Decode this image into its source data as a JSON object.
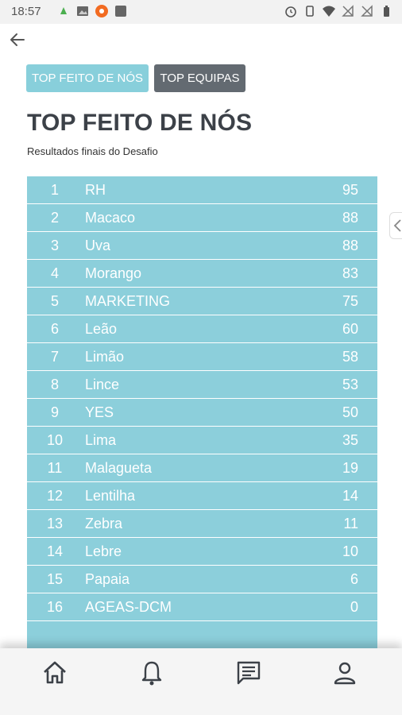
{
  "status_bar": {
    "time": "18:57"
  },
  "tabs": [
    {
      "label": "TOP FEITO DE NÓS",
      "active": true
    },
    {
      "label": "TOP EQUIPAS",
      "active": false
    }
  ],
  "page": {
    "title": "TOP FEITO DE NÓS",
    "subtitle": "Resultados finais do Desafio"
  },
  "colors": {
    "accent": "#88cfdb",
    "inactive_tab": "#636a71",
    "title": "#3c4148"
  },
  "ranking": [
    {
      "pos": "1",
      "name": "RH",
      "score": "95"
    },
    {
      "pos": "2",
      "name": "Macaco",
      "score": "88"
    },
    {
      "pos": "3",
      "name": "Uva",
      "score": "88"
    },
    {
      "pos": "4",
      "name": "Morango",
      "score": "83"
    },
    {
      "pos": "5",
      "name": "MARKETING",
      "score": "75"
    },
    {
      "pos": "6",
      "name": "Leão",
      "score": "60"
    },
    {
      "pos": "7",
      "name": "Limão",
      "score": "58"
    },
    {
      "pos": "8",
      "name": "Lince",
      "score": "53"
    },
    {
      "pos": "9",
      "name": "YES",
      "score": "50"
    },
    {
      "pos": "10",
      "name": "Lima",
      "score": "35"
    },
    {
      "pos": "11",
      "name": "Malagueta",
      "score": "19"
    },
    {
      "pos": "12",
      "name": "Lentilha",
      "score": "14"
    },
    {
      "pos": "13",
      "name": "Zebra",
      "score": "11"
    },
    {
      "pos": "14",
      "name": "Lebre",
      "score": "10"
    },
    {
      "pos": "15",
      "name": "Papaia",
      "score": "6"
    },
    {
      "pos": "16",
      "name": "AGEAS-DCM",
      "score": "0"
    }
  ],
  "icons": {
    "back": "arrow-left-icon",
    "share": "share-icon",
    "nav": [
      "home-icon",
      "bell-icon",
      "chat-icon",
      "profile-icon"
    ]
  }
}
